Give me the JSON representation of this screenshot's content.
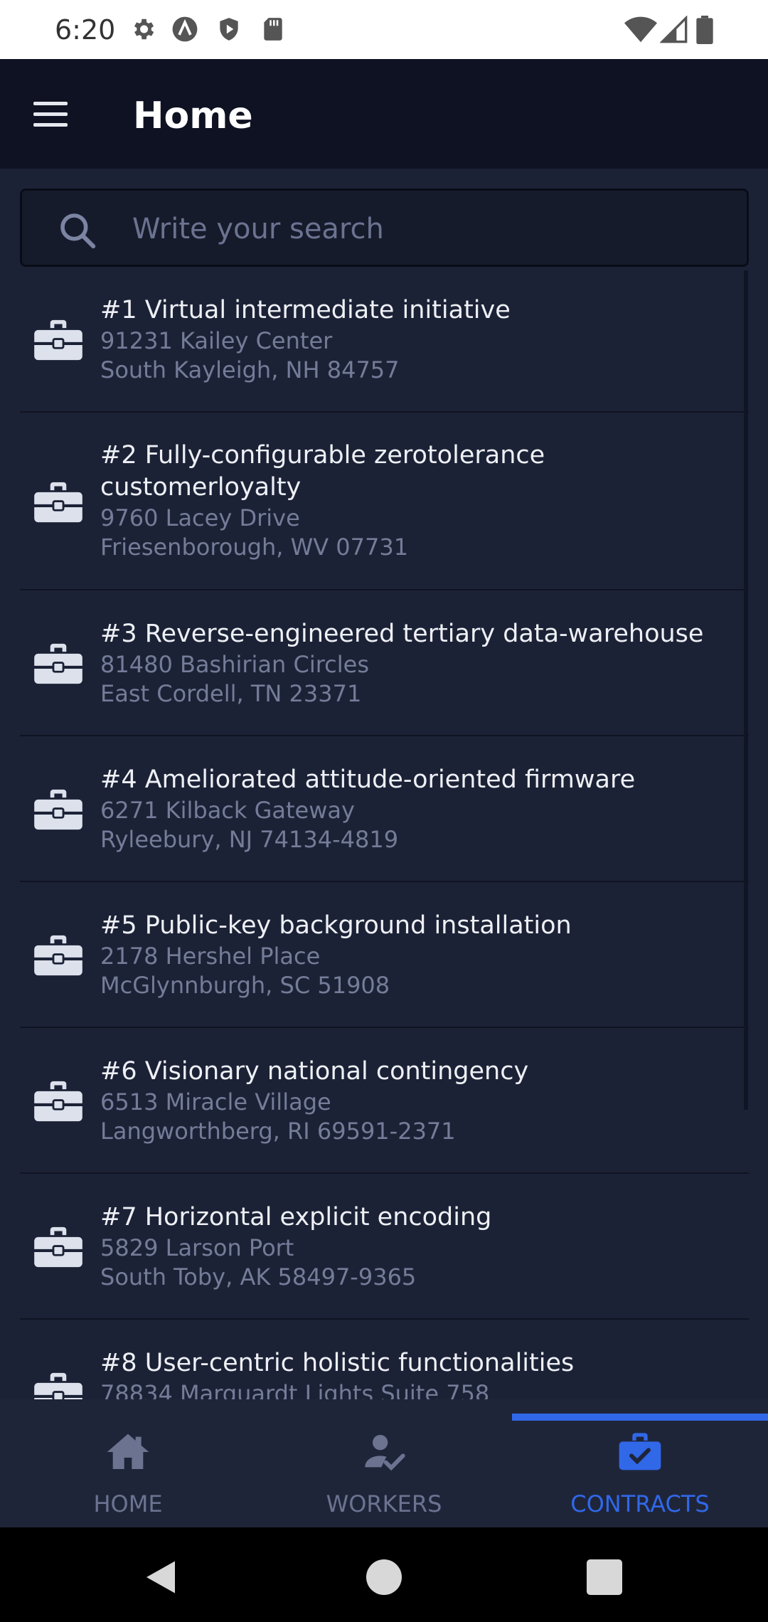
{
  "status_bar": {
    "time": "6:20",
    "left_icons": [
      "gear-icon",
      "a-logo-icon",
      "shield-icon",
      "sd-card-icon"
    ],
    "right_icons": [
      "wifi-icon",
      "cellular-icon",
      "battery-icon"
    ]
  },
  "app_bar": {
    "title": "Home",
    "menu_icon": "hamburger-menu-icon"
  },
  "search": {
    "placeholder": "Write your search",
    "value": ""
  },
  "contracts": [
    {
      "title": "#1 Virtual intermediate initiative",
      "address_line1": "91231 Kailey Center",
      "address_line2": "South Kayleigh, NH 84757"
    },
    {
      "title": "#2 Fully-configurable zerotolerance customerloyalty",
      "address_line1": "9760 Lacey Drive",
      "address_line2": "Friesenborough, WV 07731"
    },
    {
      "title": "#3 Reverse-engineered tertiary data-warehouse",
      "address_line1": "81480 Bashirian Circles",
      "address_line2": "East Cordell, TN 23371"
    },
    {
      "title": "#4 Ameliorated attitude-oriented firmware",
      "address_line1": "6271 Kilback Gateway",
      "address_line2": "Ryleebury, NJ 74134-4819"
    },
    {
      "title": "#5 Public-key background installation",
      "address_line1": "2178 Hershel Place",
      "address_line2": "McGlynnburgh, SC 51908"
    },
    {
      "title": "#6 Visionary national contingency",
      "address_line1": "6513 Miracle Village",
      "address_line2": "Langworthberg, RI 69591-2371"
    },
    {
      "title": "#7 Horizontal explicit encoding",
      "address_line1": "5829 Larson Port",
      "address_line2": "South Toby, AK 58497-9365"
    },
    {
      "title": "#8 User-centric holistic functionalities",
      "address_line1": "78834 Marquardt Lights Suite 758",
      "address_line2": ""
    }
  ],
  "bottom_nav": {
    "items": [
      {
        "label": "HOME",
        "icon": "home-icon"
      },
      {
        "label": "WORKERS",
        "icon": "worker-check-icon"
      },
      {
        "label": "CONTRACTS",
        "icon": "briefcase-check-icon"
      }
    ],
    "active": "CONTRACTS"
  },
  "colors": {
    "background": "#1c2236",
    "app_bar": "#0e1222",
    "accent": "#3068e8",
    "muted_text": "#747c98"
  }
}
